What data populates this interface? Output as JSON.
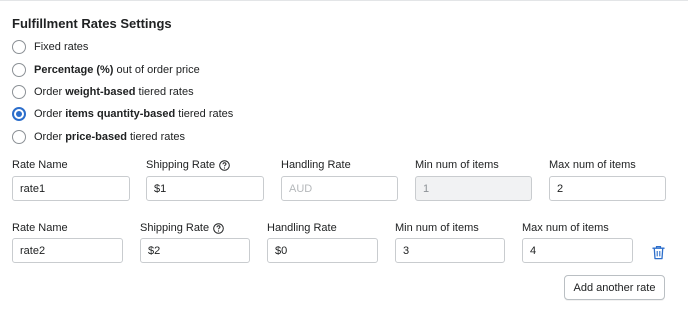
{
  "section": {
    "title": "Fulfillment Rates Settings"
  },
  "rate_options": [
    {
      "pre": "",
      "bold": "",
      "post": "Fixed rates",
      "checked": false
    },
    {
      "pre": "",
      "bold": "Percentage (%)",
      "post": " out of order price",
      "checked": false
    },
    {
      "pre": "Order ",
      "bold": "weight-based",
      "post": " tiered rates",
      "checked": false
    },
    {
      "pre": "Order ",
      "bold": "items quantity-based",
      "post": " tiered rates",
      "checked": true
    },
    {
      "pre": "Order ",
      "bold": "price-based",
      "post": " tiered rates",
      "checked": false
    }
  ],
  "rates": [
    {
      "labels": {
        "rate_name": "Rate Name",
        "shipping_rate": "Shipping Rate",
        "handling_rate": "Handling Rate",
        "min_items": "Min num of items",
        "max_items": "Max num of items"
      },
      "rate_name": "rate1",
      "shipping_rate": "$1",
      "handling_rate": "",
      "handling_placeholder": "AUD",
      "min_items": "1",
      "max_items": "2"
    },
    {
      "labels": {
        "rate_name": "Rate Name",
        "shipping_rate": "Shipping Rate",
        "handling_rate": "Handling Rate",
        "min_items": "Min num of items",
        "max_items": "Max num of items"
      },
      "rate_name": "rate2",
      "shipping_rate": "$2",
      "handling_rate": "$0",
      "min_items": "3",
      "max_items": "4"
    }
  ],
  "actions": {
    "add_rate_label": "Add another rate"
  },
  "icons": {
    "help": "question-circle-icon",
    "delete": "trash-icon"
  },
  "colors": {
    "accent": "#2c6ecb",
    "text": "#202223",
    "border": "#c9cccf",
    "disabled_bg": "#f1f2f3"
  }
}
